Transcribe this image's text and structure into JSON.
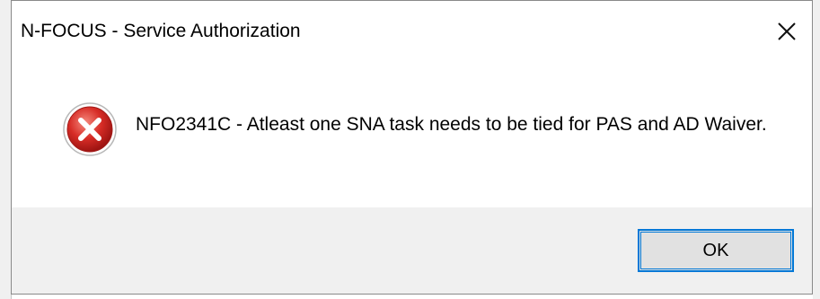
{
  "dialog": {
    "title": "N-FOCUS - Service Authorization",
    "message": "NFO2341C - Atleast one SNA task needs to be tied for PAS and AD Waiver.",
    "ok_label": "OK"
  },
  "icons": {
    "close": "close-icon",
    "error": "error-icon"
  },
  "colors": {
    "error_red": "#d72c26",
    "focus_blue": "#0078d7",
    "button_bar": "#f0f0f0"
  }
}
